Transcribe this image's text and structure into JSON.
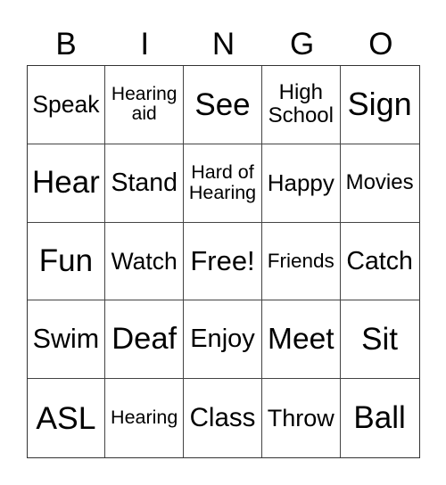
{
  "header": {
    "letters": [
      "B",
      "I",
      "N",
      "G",
      "O"
    ]
  },
  "grid": {
    "rows": [
      [
        "Speak",
        "Hearing\naid",
        "See",
        "High\nSchool",
        "Sign"
      ],
      [
        "Hear",
        "Stand",
        "Hard of\nHearing",
        "Happy",
        "Movies"
      ],
      [
        "Fun",
        "Watch",
        "Free!",
        "Friends",
        "Catch"
      ],
      [
        "Swim",
        "Deaf",
        "Enjoy",
        "Meet",
        "Sit"
      ],
      [
        "ASL",
        "Hearing",
        "Class",
        "Throw",
        "Ball"
      ]
    ]
  },
  "colors": {
    "grid_line": "#444444",
    "text": "#000000",
    "background": "#ffffff"
  }
}
